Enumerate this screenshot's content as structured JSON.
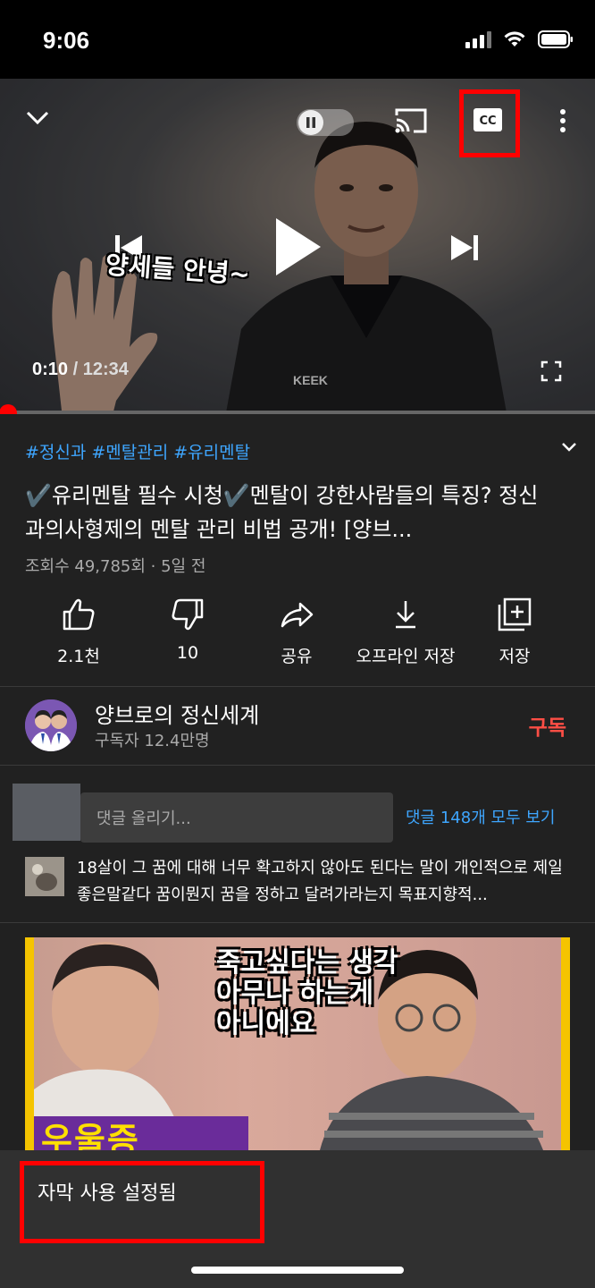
{
  "status_bar": {
    "time": "9:06",
    "icons": [
      "signal-icon",
      "wifi-icon",
      "battery-icon"
    ]
  },
  "player": {
    "subtitle": "양세들 안녕~",
    "current_time": "0:10",
    "separator": " / ",
    "total_time": "12:34",
    "shirt_text": "KEEK",
    "progress_fraction": 0.013,
    "icons": [
      "chevron-down-icon",
      "pause-icon",
      "cast-icon",
      "cc-icon",
      "more-vert-icon",
      "previous-icon",
      "play-icon",
      "next-icon",
      "fullscreen-icon"
    ],
    "accent_color": "#ff0000"
  },
  "video": {
    "hashtags": [
      "#정신과",
      "#멘탈관리",
      "#유리멘탈"
    ],
    "title": "✔️유리멘탈 필수 시청✔️멘탈이 강한사람들의 특징? 정신과의사형제의 멘탈 관리 비법 공개! [양브...",
    "meta": "조회수 49,785회 · 5일 전"
  },
  "actions": [
    {
      "icon": "like-icon",
      "label": "2.1천"
    },
    {
      "icon": "dislike-icon",
      "label": "10"
    },
    {
      "icon": "share-icon",
      "label": "공유"
    },
    {
      "icon": "download-icon",
      "label": "오프라인 저장"
    },
    {
      "icon": "save-playlist-icon",
      "label": "저장"
    }
  ],
  "channel": {
    "name": "양브로의 정신세계",
    "subscribers": "구독자 12.4만명",
    "subscribe_label": "구독",
    "subscribe_color": "#ff4e45"
  },
  "comments": {
    "placeholder": "댓글 올리기...",
    "view_all": "댓글 148개 모두 보기",
    "top_comment": "18살이 그 꿈에 대해 너무 확고하지 않아도 된다는 말이 개인적으로 제일 좋은말같다 꿈이뭔지 꿈을 정하고 달려가라는지 목표지향적..."
  },
  "next_video": {
    "caption_lines": [
      "죽고싶다는 생각",
      "아무나 하는게",
      "아니에요"
    ],
    "bottom_text": "우울증"
  },
  "toast": {
    "message": "자막 사용 설정됨"
  }
}
